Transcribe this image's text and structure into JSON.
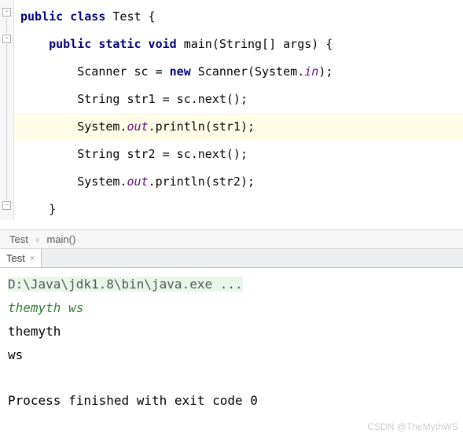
{
  "code": {
    "line1": {
      "prefix": "public class ",
      "class_name": "Test",
      "suffix": " {"
    },
    "line2": {
      "modifiers": "public static void ",
      "method": "main",
      "params": "(String[] args) {"
    },
    "line3": {
      "t1": "Scanner sc = ",
      "new_kw": "new ",
      "t2": "Scanner(System.",
      "field": "in",
      "t3": ");"
    },
    "line4": "String str1 = sc.next();",
    "line5": {
      "t1": "System.",
      "field": "out",
      "t2": ".println(str1);"
    },
    "line6": "String str2 = sc.next();",
    "line7": {
      "t1": "System.",
      "field": "out",
      "t2": ".println(str2);"
    },
    "line8": "}"
  },
  "breadcrumb": {
    "class": "Test",
    "method": "main()"
  },
  "tab": {
    "label": "Test",
    "close": "×"
  },
  "console": {
    "command": "D:\\Java\\jdk1.8\\bin\\java.exe ...",
    "input": "themyth ws",
    "out1": "themyth",
    "out2": "ws",
    "exit": "Process finished with exit code 0"
  },
  "watermark": "CSDN @TheMythWS"
}
